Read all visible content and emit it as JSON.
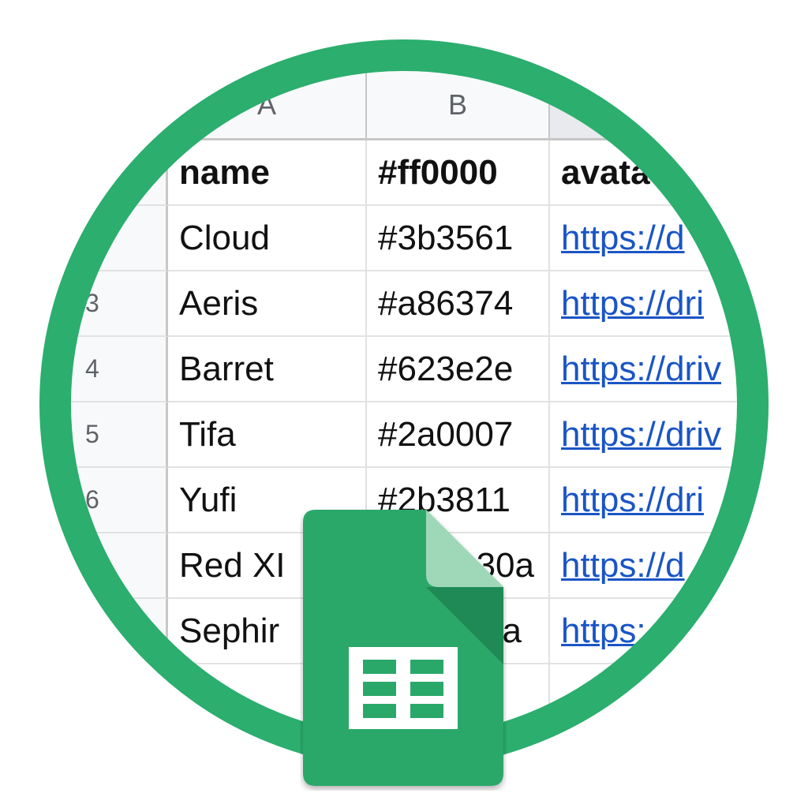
{
  "colors": {
    "ring": "#2bae6e",
    "logo_body": "#2aa86a",
    "logo_fold": "#9fd8b8",
    "logo_fold_shadow": "#1f8a55",
    "link": "#1a55c6"
  },
  "sheet": {
    "column_headers": [
      "A",
      "B",
      ""
    ],
    "row_numbers": [
      "",
      "",
      "3",
      "4",
      "5",
      "6",
      "",
      ""
    ],
    "rows": [
      {
        "name": "name",
        "color": "#ff0000",
        "avatar": "avata"
      },
      {
        "name": "Cloud",
        "color": "#3b3561",
        "avatar": "https://d"
      },
      {
        "name": "Aeris",
        "color": "#a86374",
        "avatar": "https://dri"
      },
      {
        "name": "Barret",
        "color": "#623e2e",
        "avatar": "https://driv"
      },
      {
        "name": "Tifa",
        "color": "#2a0007",
        "avatar": "https://driv"
      },
      {
        "name": "Yufi",
        "color": "#2b3811",
        "avatar": "https://dri"
      },
      {
        "name": "Red XI",
        "color": "30a",
        "avatar": "https://d"
      },
      {
        "name": "Sephir",
        "color": "a",
        "avatar": "https:"
      }
    ]
  },
  "logo": {
    "icon": "google-sheets-icon"
  }
}
